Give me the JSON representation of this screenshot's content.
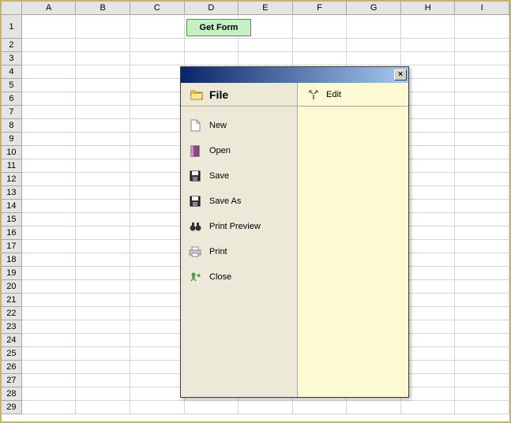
{
  "spreadsheet": {
    "columns": [
      "A",
      "B",
      "C",
      "D",
      "E",
      "F",
      "G",
      "H",
      "I"
    ],
    "rows": [
      "1",
      "2",
      "3",
      "4",
      "5",
      "6",
      "7",
      "8",
      "9",
      "10",
      "11",
      "12",
      "13",
      "14",
      "15",
      "16",
      "17",
      "18",
      "19",
      "20",
      "21",
      "22",
      "23",
      "24",
      "25",
      "26",
      "27",
      "28",
      "29"
    ]
  },
  "button": {
    "get_form": "Get Form"
  },
  "dialog": {
    "tabs": {
      "file": "File",
      "edit": "Edit"
    },
    "menu": {
      "new": "New",
      "open": "Open",
      "save": "Save",
      "save_as": "Save As",
      "print_preview": "Print Preview",
      "print": "Print",
      "close": "Close"
    },
    "close_x": "×"
  }
}
